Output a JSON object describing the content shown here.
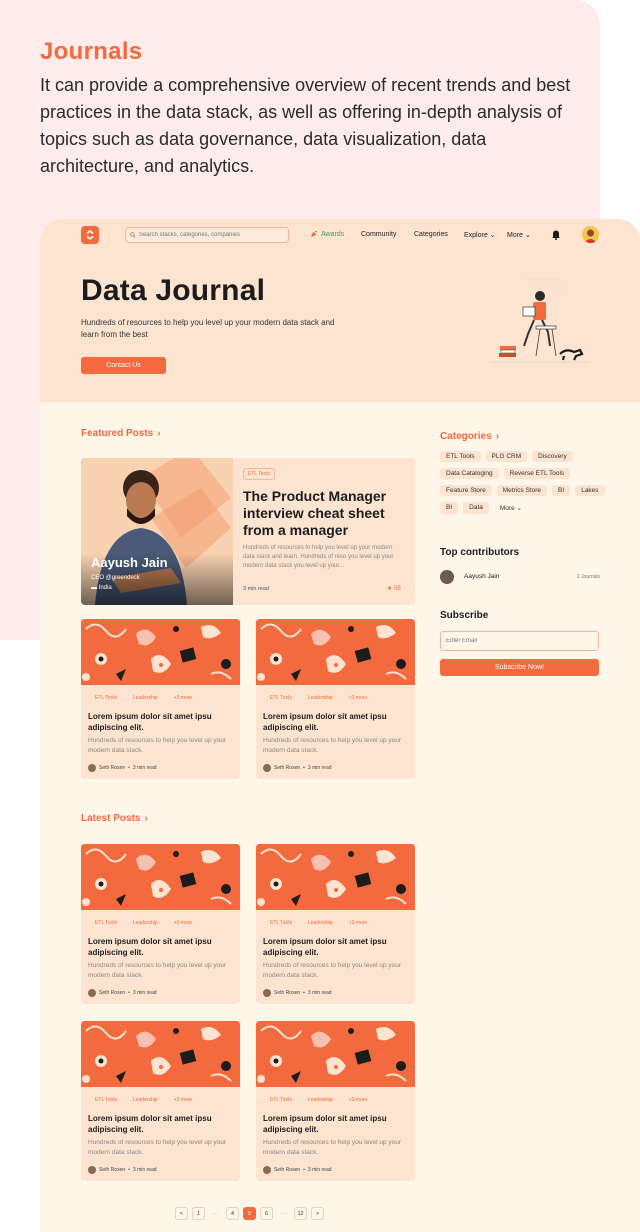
{
  "intro": {
    "title": "Journals",
    "text": "It can provide a comprehensive overview of recent trends and best practices in the data stack, as well as offering in-depth analysis of topics such as data governance, data visualization, data architecture, and analytics."
  },
  "nav": {
    "search_placeholder": "Search stacks, categories, companies",
    "awards": "Awards",
    "community": "Community",
    "categories": "Categories",
    "explore": "Explore",
    "more": "More"
  },
  "hero": {
    "title": "Data Journal",
    "subtitle": "Hundreds of resources to help you level up your modern data stack and learn from the best",
    "button": "Contact Us"
  },
  "featured": {
    "heading": "Featured Posts",
    "tag": "ETL Tools",
    "title": "The Product Manager interview cheat sheet from a manager",
    "desc": "Hundreds of resources to help you level up your modern data stack and learn. Hundreds of reso you level up your modern data stack you level up your...",
    "read": "3 min read",
    "stars": "55",
    "person_name": "Aayush Jain",
    "person_role": "CEO @greendeck",
    "person_country": "India"
  },
  "card_template": {
    "tags": [
      "ETL Tools",
      "Leadership",
      "+3 more"
    ],
    "title": "Lorem ipsum dolor sit amet ipsu adipiscing elit.",
    "desc": "Hundreds of resources to help you level up your modern data stack.",
    "author": "Seth Rosen",
    "read": "3 min read"
  },
  "latest": {
    "heading": "Latest Posts"
  },
  "sidebar": {
    "categories_heading": "Categories",
    "chips": [
      "ETL Tools",
      "PLG CRM",
      "Discovery",
      "Data Cataloging",
      "Reverse ETL Tools",
      "Feature Store",
      "Metrics Store",
      "BI",
      "Lakes",
      "BI",
      "Data",
      "More"
    ],
    "contributors_heading": "Top contributors",
    "contributor_name": "Aayush Jain",
    "contributor_count": "2 Journals",
    "subscribe_heading": "Subscribe",
    "email_placeholder": "Enter Email",
    "subscribe_button": "Subscribe Now!"
  },
  "pagination": [
    "<",
    "1",
    "···",
    "4",
    "5",
    "6",
    "···",
    "12",
    ">"
  ],
  "colors": {
    "accent": "#f26a3e",
    "page_bg": "#fff6ea",
    "band": "#fde4d0",
    "intro_bg": "#fdecea"
  }
}
